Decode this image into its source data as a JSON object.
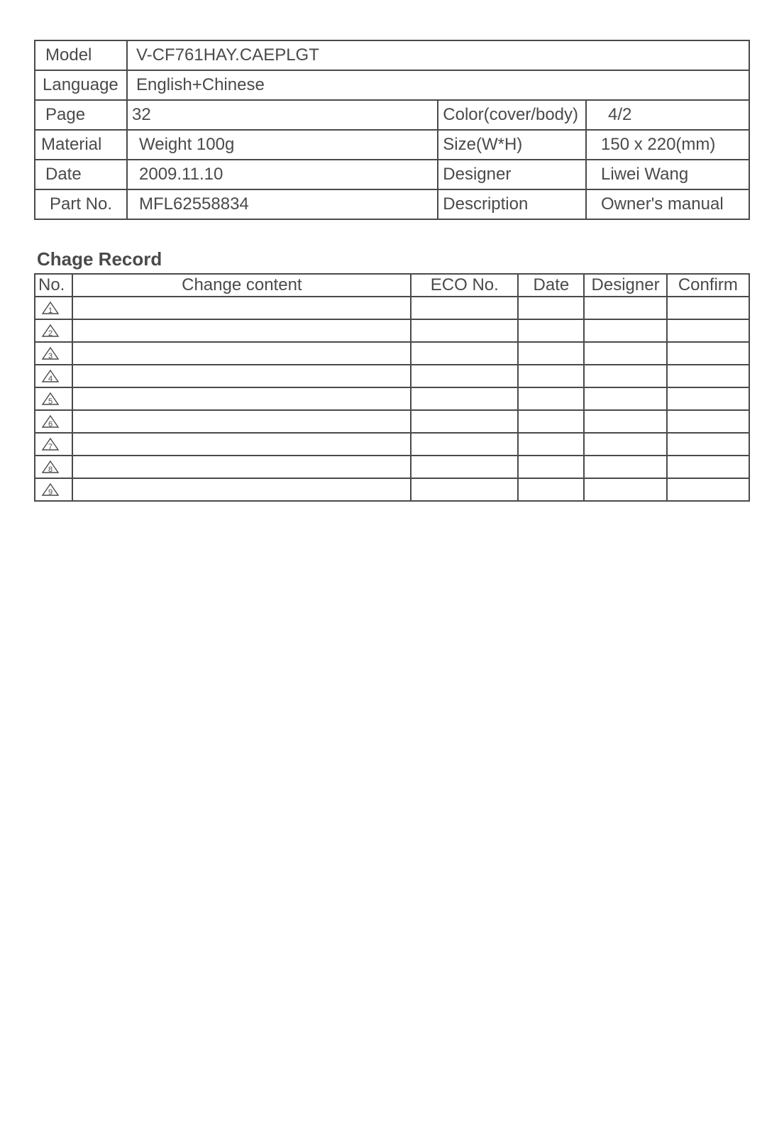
{
  "spec": {
    "rows": [
      {
        "l1": "Model",
        "v1": "V-CF761HAY.CAEPLGT",
        "l2": "",
        "v2": ""
      },
      {
        "l1": "Language",
        "v1": "English+Chinese",
        "l2": "",
        "v2": ""
      },
      {
        "l1": "Page",
        "v1": "32",
        "l2": "Color(cover/body)",
        "v2": "4/2"
      },
      {
        "l1": "Material",
        "v1": "Weight 100g",
        "l2": "Size(W*H)",
        "v2": "150 x 220(mm)"
      },
      {
        "l1": "Date",
        "v1": "2009.11.10",
        "l2": "Designer",
        "v2": "Liwei Wang"
      },
      {
        "l1": "Part No.",
        "v1": "MFL62558834",
        "l2": "Description",
        "v2": "Owner's manual"
      }
    ]
  },
  "change_record": {
    "title": "Chage Record",
    "headers": {
      "no": "No.",
      "content": "Change content",
      "eco": "ECO No.",
      "date": "Date",
      "designer": "Designer",
      "confirm": "Confirm"
    },
    "rows": [
      {
        "no": "1",
        "content": "",
        "eco": "",
        "date": "",
        "designer": "",
        "confirm": ""
      },
      {
        "no": "2",
        "content": "",
        "eco": "",
        "date": "",
        "designer": "",
        "confirm": ""
      },
      {
        "no": "3",
        "content": "",
        "eco": "",
        "date": "",
        "designer": "",
        "confirm": ""
      },
      {
        "no": "4",
        "content": "",
        "eco": "",
        "date": "",
        "designer": "",
        "confirm": ""
      },
      {
        "no": "5",
        "content": "",
        "eco": "",
        "date": "",
        "designer": "",
        "confirm": ""
      },
      {
        "no": "6",
        "content": "",
        "eco": "",
        "date": "",
        "designer": "",
        "confirm": ""
      },
      {
        "no": "7",
        "content": "",
        "eco": "",
        "date": "",
        "designer": "",
        "confirm": ""
      },
      {
        "no": "8",
        "content": "",
        "eco": "",
        "date": "",
        "designer": "",
        "confirm": ""
      },
      {
        "no": "9",
        "content": "",
        "eco": "",
        "date": "",
        "designer": "",
        "confirm": ""
      }
    ]
  }
}
